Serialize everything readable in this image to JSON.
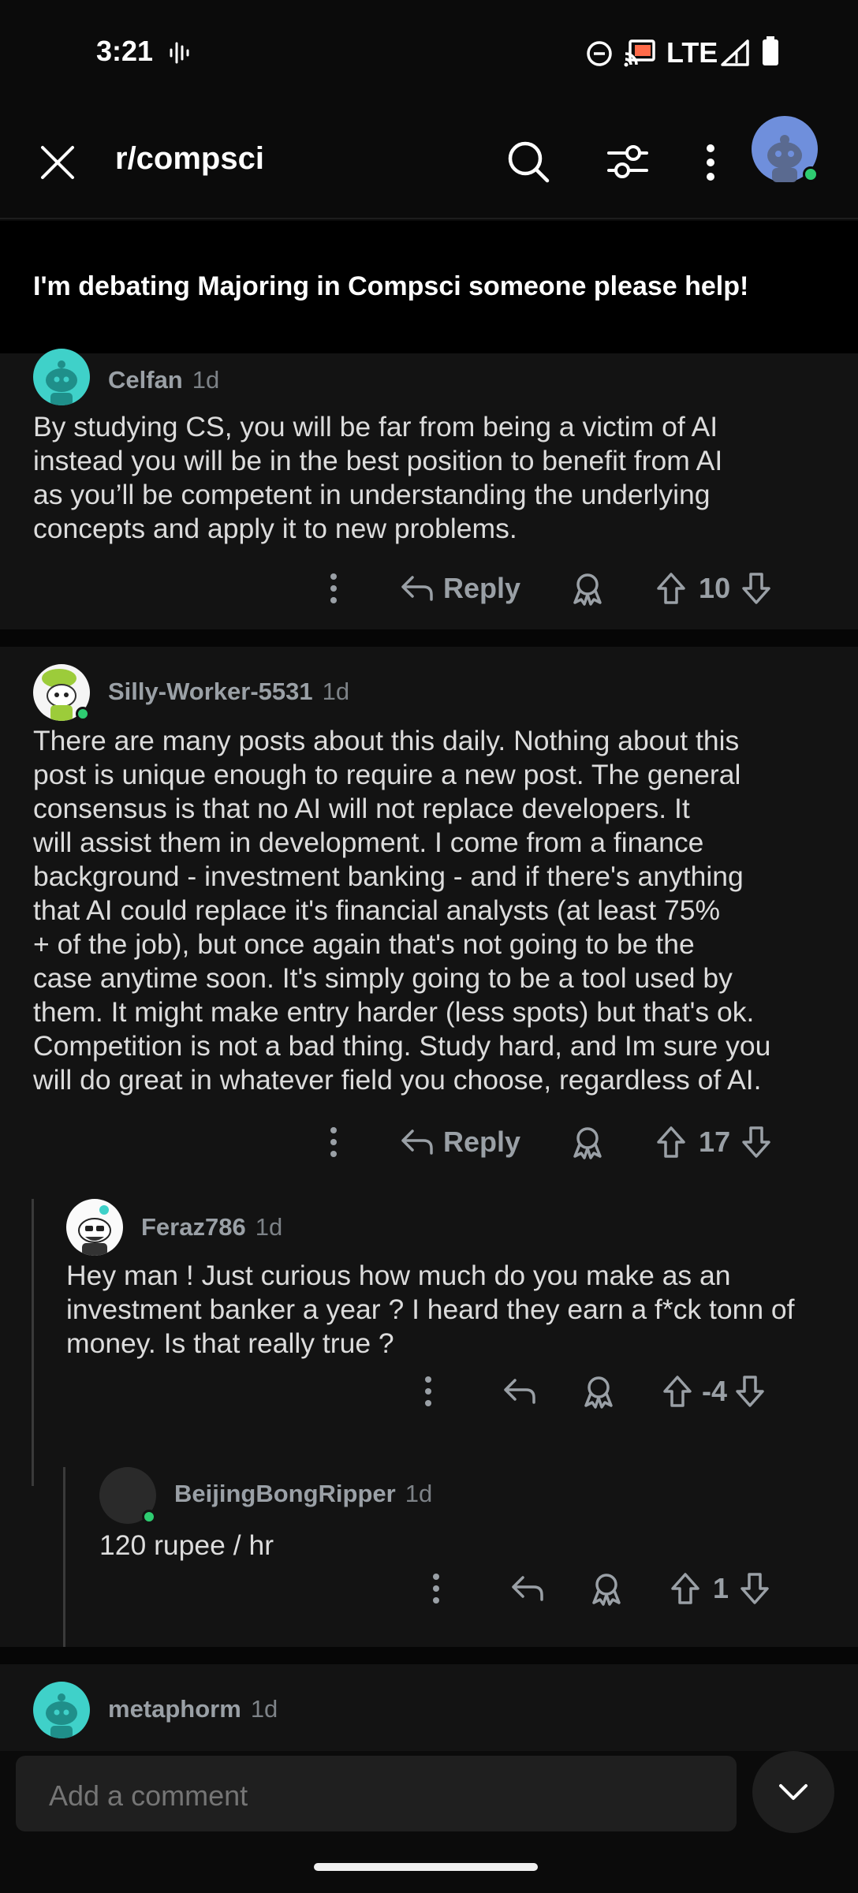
{
  "status_bar": {
    "time": "3:21",
    "network": "LTE"
  },
  "header": {
    "subreddit": "r/compsci"
  },
  "post": {
    "title": "I'm debating Majoring in Compsci someone please help!"
  },
  "comments": [
    {
      "user": "Celfan",
      "time": "1d",
      "body": [
        "By studying CS, you will be far from being a victim of AI",
        "instead you will be in the best position to benefit from AI",
        "as you’ll be competent in understanding the underlying",
        "concepts and apply it to new problems."
      ],
      "reply_label": "Reply",
      "votes": "10"
    },
    {
      "user": "Silly-Worker-5531",
      "time": "1d",
      "body": [
        "There are many posts about this daily. Nothing about this",
        "post is unique enough to require a new post. The general",
        "consensus is that no AI will not replace developers. It",
        "will assist them in development. I come from a finance",
        "background - investment banking - and if there's anything",
        "that AI could replace it's financial analysts (at least 75%",
        "+ of the job), but once again that's not going to be the",
        "case anytime soon. It's simply going to be a tool used by",
        "them. It might make entry harder (less spots) but that's ok.",
        "Competition is not a bad thing. Study hard, and Im sure you",
        "will do great in whatever field you choose, regardless of AI."
      ],
      "reply_label": "Reply",
      "votes": "17"
    },
    {
      "user": "Feraz786",
      "time": "1d",
      "body": [
        "Hey man ! Just curious how much do you make as an",
        "investment banker a year ? I heard they earn a f*ck tonn of",
        "money. Is that really true ?"
      ],
      "votes": "-4"
    },
    {
      "user": "BeijingBongRipper",
      "time": "1d",
      "body": [
        "120 rupee / hr"
      ],
      "votes": "1"
    },
    {
      "user": "metaphorm",
      "time": "1d"
    }
  ],
  "composer": {
    "placeholder": "Add a comment"
  },
  "colors": {
    "background": "#0b0b0b",
    "card": "#131313",
    "online": "#2ecc71",
    "avatar_blue": "#6f8fdc",
    "avatar_teal": "#3fd1c9"
  }
}
